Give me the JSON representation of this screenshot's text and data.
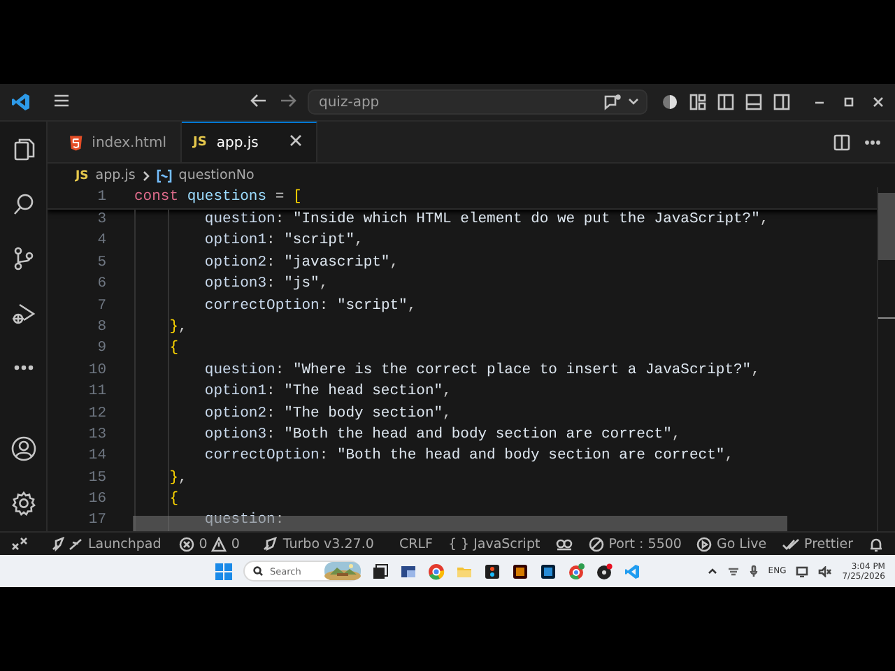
{
  "title_bar": {
    "command_center": "quiz-app"
  },
  "tabs": [
    {
      "label": "index.html",
      "kind": "html",
      "selected": false
    },
    {
      "label": "app.js",
      "kind": "js",
      "badge": "JS",
      "selected": true
    }
  ],
  "breadcrumb": {
    "badge": "JS",
    "file": "app.js",
    "symbol": "questionNo"
  },
  "editor": {
    "sticky_line": {
      "number": "1",
      "tokens": [
        {
          "text": "const ",
          "kind": "keyword"
        },
        {
          "text": "questions",
          "kind": "variable"
        },
        {
          "text": " = ",
          "kind": "punct"
        },
        {
          "text": "[",
          "kind": "bracket"
        }
      ]
    },
    "lines": [
      {
        "number": "3",
        "tokens": [
          {
            "text": "        question",
            "kind": "property"
          },
          {
            "text": ": ",
            "kind": "punct"
          },
          {
            "text": "\"Inside which HTML element do we put the JavaScript?\"",
            "kind": "string"
          },
          {
            "text": ",",
            "kind": "punct"
          }
        ]
      },
      {
        "number": "4",
        "tokens": [
          {
            "text": "        option1",
            "kind": "property"
          },
          {
            "text": ": ",
            "kind": "punct"
          },
          {
            "text": "\"script\"",
            "kind": "string"
          },
          {
            "text": ",",
            "kind": "punct"
          }
        ]
      },
      {
        "number": "5",
        "tokens": [
          {
            "text": "        option2",
            "kind": "property"
          },
          {
            "text": ": ",
            "kind": "punct"
          },
          {
            "text": "\"javascript\"",
            "kind": "string"
          },
          {
            "text": ",",
            "kind": "punct"
          }
        ]
      },
      {
        "number": "6",
        "tokens": [
          {
            "text": "        option3",
            "kind": "property"
          },
          {
            "text": ": ",
            "kind": "punct"
          },
          {
            "text": "\"js\"",
            "kind": "string"
          },
          {
            "text": ",",
            "kind": "punct"
          }
        ]
      },
      {
        "number": "7",
        "tokens": [
          {
            "text": "        correctOption",
            "kind": "property"
          },
          {
            "text": ": ",
            "kind": "punct"
          },
          {
            "text": "\"script\"",
            "kind": "string"
          },
          {
            "text": ",",
            "kind": "punct"
          }
        ]
      },
      {
        "number": "8",
        "tokens": [
          {
            "text": "    }",
            "kind": "bracket"
          },
          {
            "text": ",",
            "kind": "punct"
          }
        ]
      },
      {
        "number": "9",
        "tokens": [
          {
            "text": "    {",
            "kind": "bracket"
          }
        ]
      },
      {
        "number": "10",
        "tokens": [
          {
            "text": "        question",
            "kind": "property"
          },
          {
            "text": ": ",
            "kind": "punct"
          },
          {
            "text": "\"Where is the correct place to insert a JavaScript?\"",
            "kind": "string"
          },
          {
            "text": ",",
            "kind": "punct"
          }
        ]
      },
      {
        "number": "11",
        "tokens": [
          {
            "text": "        option1",
            "kind": "property"
          },
          {
            "text": ": ",
            "kind": "punct"
          },
          {
            "text": "\"The head section\"",
            "kind": "string"
          },
          {
            "text": ",",
            "kind": "punct"
          }
        ]
      },
      {
        "number": "12",
        "tokens": [
          {
            "text": "        option2",
            "kind": "property"
          },
          {
            "text": ": ",
            "kind": "punct"
          },
          {
            "text": "\"The body section\"",
            "kind": "string"
          },
          {
            "text": ",",
            "kind": "punct"
          }
        ]
      },
      {
        "number": "13",
        "tokens": [
          {
            "text": "        option3",
            "kind": "property"
          },
          {
            "text": ": ",
            "kind": "punct"
          },
          {
            "text": "\"Both the head and body section are correct\"",
            "kind": "string"
          },
          {
            "text": ",",
            "kind": "punct"
          }
        ]
      },
      {
        "number": "14",
        "tokens": [
          {
            "text": "        correctOption",
            "kind": "property"
          },
          {
            "text": ": ",
            "kind": "punct"
          },
          {
            "text": "\"Both the head and body section are correct\"",
            "kind": "string"
          },
          {
            "text": ",",
            "kind": "punct"
          }
        ]
      },
      {
        "number": "15",
        "tokens": [
          {
            "text": "    }",
            "kind": "bracket"
          },
          {
            "text": ",",
            "kind": "punct"
          }
        ]
      },
      {
        "number": "16",
        "tokens": [
          {
            "text": "    {",
            "kind": "bracket"
          }
        ]
      },
      {
        "number": "17",
        "tokens": [
          {
            "text": "        question",
            "kind": "property"
          },
          {
            "text": ":",
            "kind": "punct"
          }
        ]
      }
    ]
  },
  "status_bar": {
    "launchpad": "Launchpad",
    "errors": "0",
    "warnings": "0",
    "turbo": "Turbo v3.27.0",
    "eol": "CRLF",
    "language_icon": "{ }",
    "language": "JavaScript",
    "port": "Port : 5500",
    "live": "Go Live",
    "formatter": "Prettier"
  },
  "taskbar": {
    "search_placeholder": "Search",
    "language": "ENG",
    "time": "3:04 PM",
    "date": "7/25/2026"
  }
}
